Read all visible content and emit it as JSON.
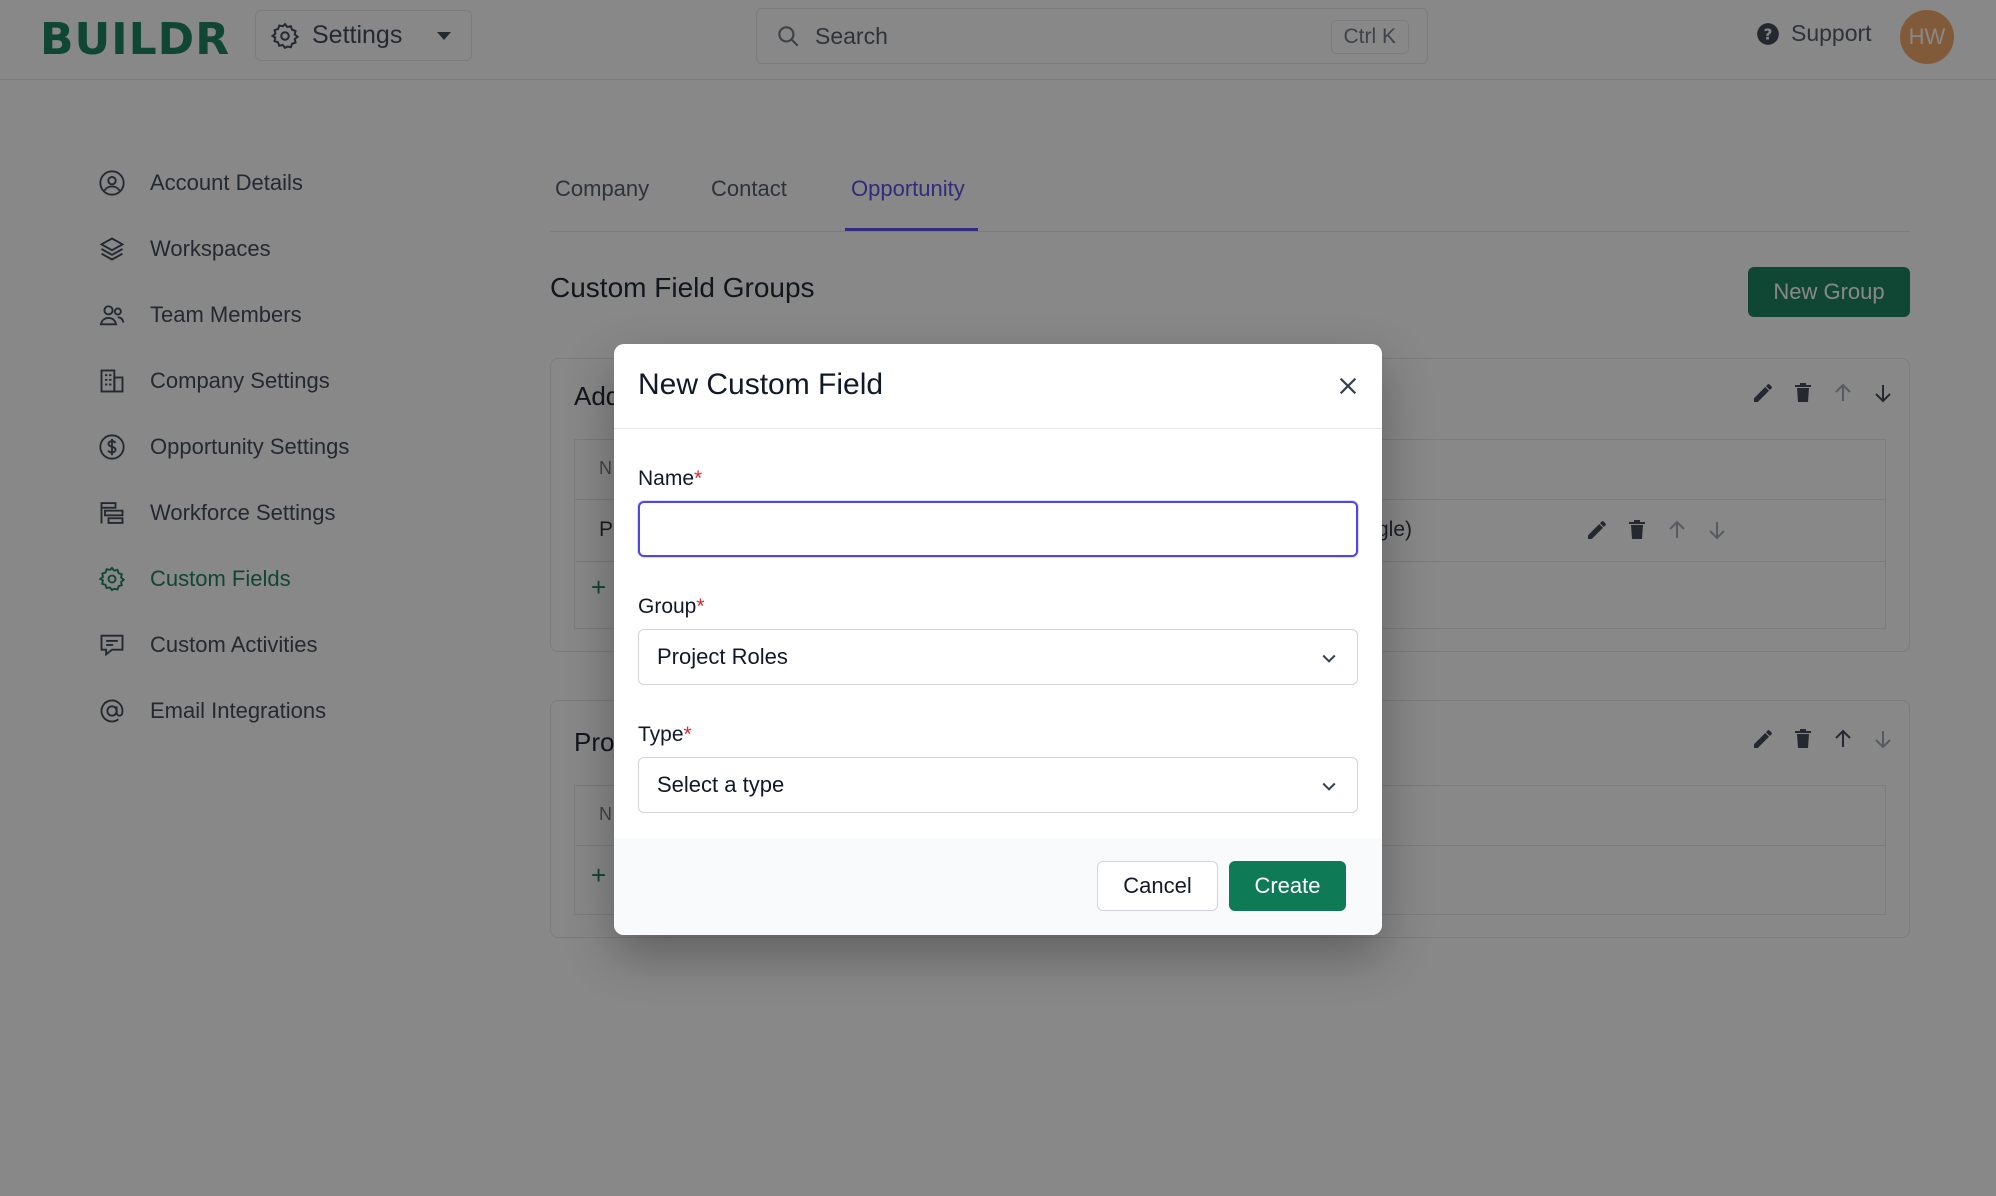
{
  "app": {
    "logo_text": "BUILDR",
    "workspace_label": "Settings",
    "search_placeholder": "Search",
    "search_shortcut": "Ctrl K",
    "support_label": "Support",
    "avatar_initials": "HW"
  },
  "sidebar": {
    "items": [
      {
        "label": "Account Details",
        "icon": "user-circle-icon",
        "active": false
      },
      {
        "label": "Workspaces",
        "icon": "layers-icon",
        "active": false
      },
      {
        "label": "Team Members",
        "icon": "users-icon",
        "active": false
      },
      {
        "label": "Company Settings",
        "icon": "building-icon",
        "active": false
      },
      {
        "label": "Opportunity Settings",
        "icon": "dollar-circle-icon",
        "active": false
      },
      {
        "label": "Workforce Settings",
        "icon": "bars-icon",
        "active": false
      },
      {
        "label": "Custom Fields",
        "icon": "gear-icon",
        "active": true
      },
      {
        "label": "Custom Activities",
        "icon": "chat-icon",
        "active": false
      },
      {
        "label": "Email Integrations",
        "icon": "at-icon",
        "active": false
      }
    ]
  },
  "main": {
    "tabs": [
      {
        "label": "Company",
        "active": false
      },
      {
        "label": "Contact",
        "active": false
      },
      {
        "label": "Opportunity",
        "active": true
      }
    ],
    "section_title": "Custom Field Groups",
    "new_group_label": "New Group",
    "groups": [
      {
        "title_fragment": "Add",
        "col_fragment": "N",
        "row_fragment": "P",
        "row_tail": "gle)"
      },
      {
        "title_fragment": "Proj",
        "col_fragment": "N"
      }
    ]
  },
  "modal": {
    "title": "New Custom Field",
    "name_label": "Name",
    "name_value": "",
    "group_label": "Group",
    "group_value": "Project Roles",
    "type_label": "Type",
    "type_value": "Select a type",
    "required_mark": "*",
    "cancel_label": "Cancel",
    "create_label": "Create"
  },
  "colors": {
    "brand": "#0f7a56",
    "accent": "#4f46e5",
    "required": "#dc2626",
    "overlay": "rgba(17,17,17,0.5)"
  }
}
